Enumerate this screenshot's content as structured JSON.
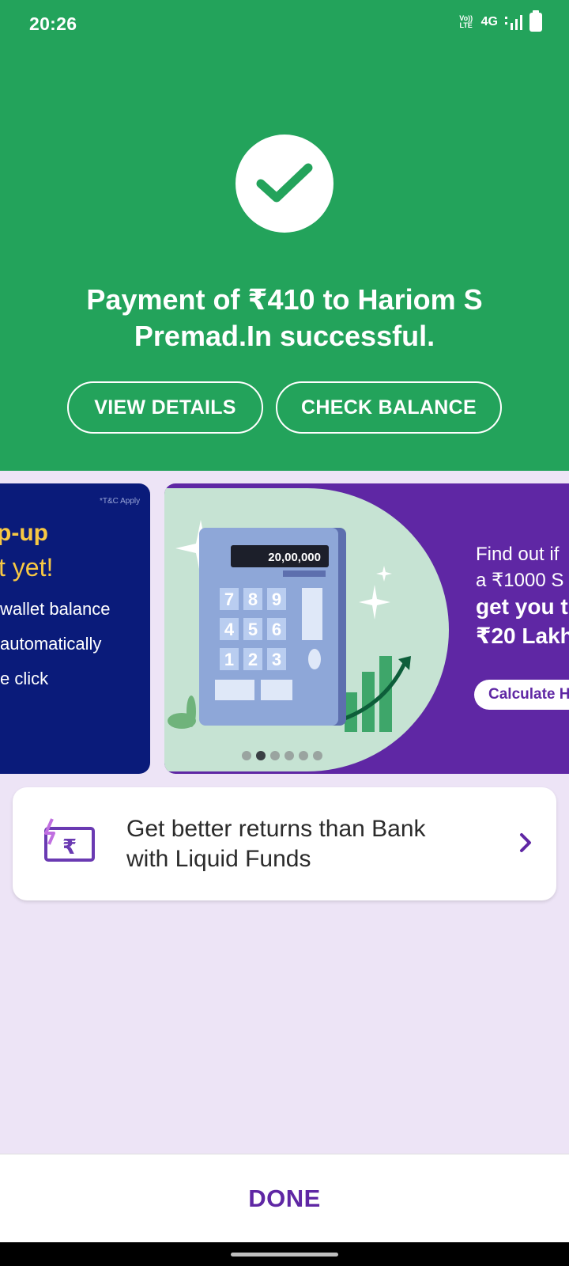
{
  "status_bar": {
    "time": "20:26",
    "volte_top": "Vo))",
    "volte_bottom": "LTE",
    "network": "4G"
  },
  "success": {
    "message": "Payment of ₹410 to Hariom S Premad.In successful.",
    "view_details_label": "VIEW DETAILS",
    "check_balance_label": "CHECK BALANCE"
  },
  "banners": {
    "left": {
      "tc": "*T&C Apply",
      "title_line1": "p-up",
      "title_line2": "t yet!",
      "lines": [
        "wallet balance",
        "automatically",
        "e click"
      ]
    },
    "right": {
      "calculator_display": "20,00,000",
      "keys": [
        "7",
        "8",
        "9",
        "4",
        "5",
        "6",
        "1",
        "2",
        "3"
      ],
      "line1": "Find out if",
      "line2": "a ₹1000 S",
      "line3": "get you t",
      "line4": "₹20 Lakh",
      "cta": "Calculate H"
    },
    "active_dot_index": 1,
    "dot_count": 6
  },
  "promo_card": {
    "line1": "Get better returns than Bank",
    "line2": "with Liquid Funds"
  },
  "footer": {
    "done_label": "DONE"
  },
  "colors": {
    "success_green": "#23a35b",
    "brand_purple": "#5f27a4",
    "page_bg": "#ede4f6"
  }
}
